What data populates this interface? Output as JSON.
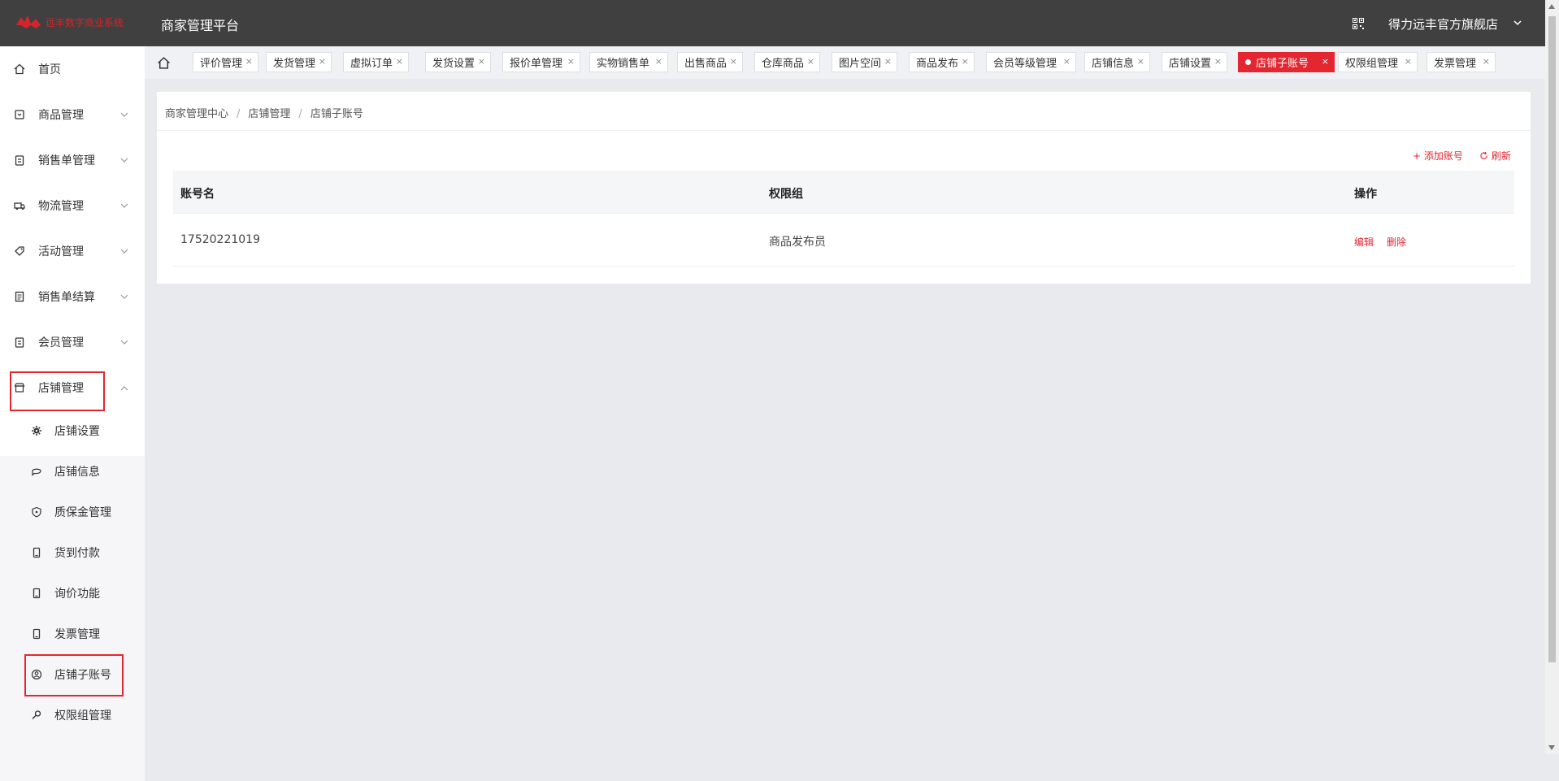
{
  "header": {
    "logo_text": "远丰数字商业系统",
    "platform_title": "商家管理平台",
    "shop_name": "得力远丰官方旗舰店"
  },
  "sidebar": {
    "items": [
      {
        "label": "首页",
        "icon": "home-icon"
      },
      {
        "label": "商品管理",
        "icon": "goods-icon"
      },
      {
        "label": "销售单管理",
        "icon": "clipboard-icon"
      },
      {
        "label": "物流管理",
        "icon": "truck-icon"
      },
      {
        "label": "活动管理",
        "icon": "tag-icon"
      },
      {
        "label": "销售单结算",
        "icon": "document-icon"
      },
      {
        "label": "会员管理",
        "icon": "clipboard-icon"
      },
      {
        "label": "店铺管理",
        "icon": "store-icon"
      }
    ],
    "sub_items": [
      {
        "label": "店铺设置",
        "icon": "gear-icon"
      },
      {
        "label": "店铺信息",
        "icon": "chat-icon"
      },
      {
        "label": "质保金管理",
        "icon": "shield-icon"
      },
      {
        "label": "货到付款",
        "icon": "phone-icon"
      },
      {
        "label": "询价功能",
        "icon": "phone-icon"
      },
      {
        "label": "发票管理",
        "icon": "phone-icon"
      },
      {
        "label": "店铺子账号",
        "icon": "user-circle-icon"
      },
      {
        "label": "权限组管理",
        "icon": "key-icon"
      }
    ]
  },
  "tabs": [
    {
      "label": "评价管理"
    },
    {
      "label": "发货管理"
    },
    {
      "label": "虚拟订单"
    },
    {
      "label": "发货设置"
    },
    {
      "label": "报价单管理"
    },
    {
      "label": "实物销售单"
    },
    {
      "label": "出售商品"
    },
    {
      "label": "仓库商品"
    },
    {
      "label": "图片空间"
    },
    {
      "label": "商品发布"
    },
    {
      "label": "会员等级管理"
    },
    {
      "label": "店铺信息"
    },
    {
      "label": "店铺设置"
    },
    {
      "label": "店铺子账号"
    },
    {
      "label": "权限组管理"
    },
    {
      "label": "发票管理"
    }
  ],
  "tab_close": "×",
  "breadcrumb": [
    "商家管理中心",
    "店铺管理",
    "店铺子账号"
  ],
  "breadcrumb_sep": "/",
  "actions": {
    "add": "+ 添加账号",
    "refresh": "刷新"
  },
  "table": {
    "columns": [
      "账号名",
      "权限组",
      "操作"
    ],
    "rows": [
      {
        "account": "17520221019",
        "group": "商品发布员",
        "edit": "编辑",
        "delete": "删除"
      }
    ]
  },
  "colors": {
    "accent": "#e3262f",
    "topbar": "#404040"
  }
}
